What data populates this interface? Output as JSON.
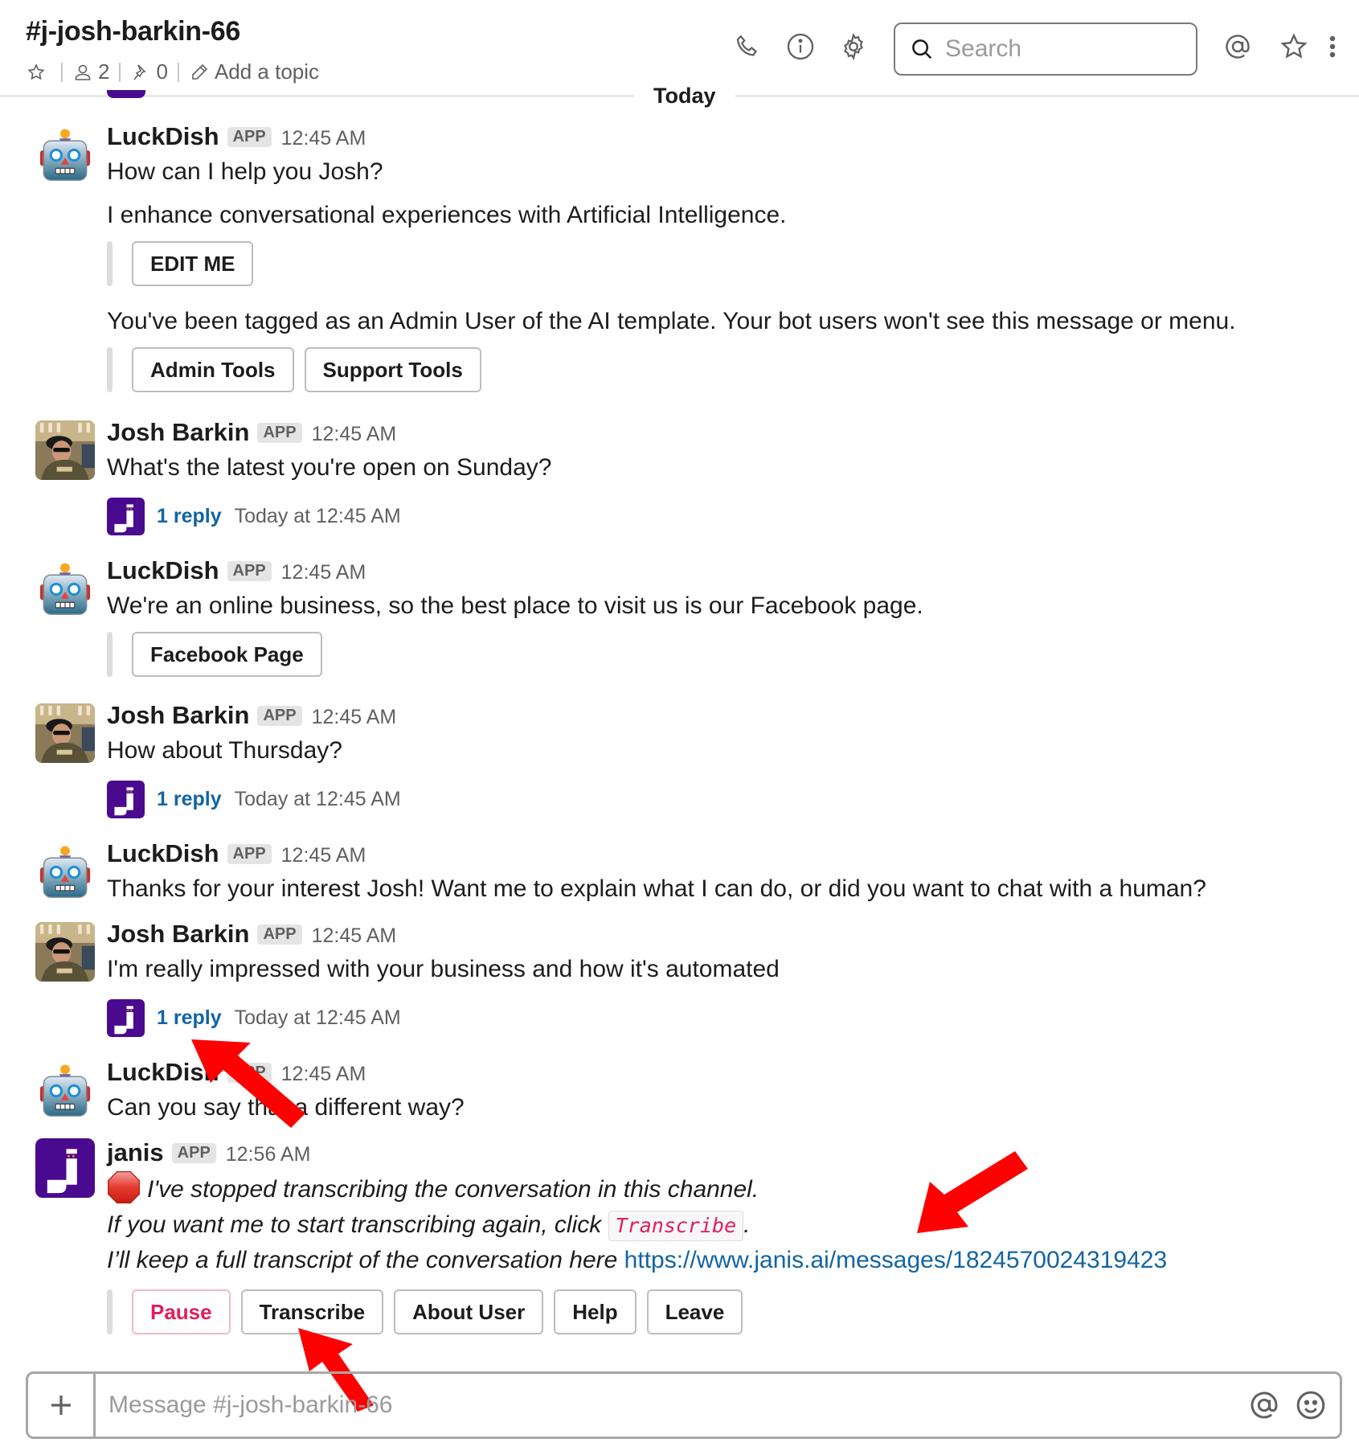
{
  "header": {
    "channel_name": "#j-josh-barkin-66",
    "member_count": "2",
    "pinned_count": "0",
    "topic_placeholder": "Add a topic",
    "search_placeholder": "Search"
  },
  "divider": {
    "label": "Today"
  },
  "messages": [
    {
      "sender": "LuckDish",
      "badge": "APP",
      "time": "12:45 AM",
      "lines": [
        "How can I help you Josh?",
        "I enhance conversational experiences with Artificial Intelligence."
      ],
      "buttons_1": [
        "EDIT ME"
      ],
      "line_2": "You've been tagged as an Admin User of the AI template. Your bot users won't see this message or menu.",
      "buttons_2": [
        "Admin Tools",
        "Support Tools"
      ]
    },
    {
      "sender": "Josh Barkin",
      "badge": "APP",
      "time": "12:45 AM",
      "text": "What's the latest you're open on Sunday?",
      "thread": {
        "reply_label": "1 reply",
        "reply_time": "Today at 12:45 AM"
      }
    },
    {
      "sender": "LuckDish",
      "badge": "APP",
      "time": "12:45 AM",
      "text": "We're an online business, so the best place to visit us is our Facebook page.",
      "buttons": [
        "Facebook Page"
      ]
    },
    {
      "sender": "Josh Barkin",
      "badge": "APP",
      "time": "12:45 AM",
      "text": "How about Thursday?",
      "thread": {
        "reply_label": "1 reply",
        "reply_time": "Today at 12:45 AM"
      }
    },
    {
      "sender": "LuckDish",
      "badge": "APP",
      "time": "12:45 AM",
      "text": "Thanks for your interest Josh! Want me to explain what I can do, or did you want to chat with a human?"
    },
    {
      "sender": "Josh Barkin",
      "badge": "APP",
      "time": "12:45 AM",
      "text": "I'm really impressed with your business and how it's automated",
      "thread": {
        "reply_label": "1 reply",
        "reply_time": "Today at 12:45 AM"
      }
    },
    {
      "sender": "LuckDish",
      "badge": "APP",
      "time": "12:45 AM",
      "text": "Can you say that a different way?"
    },
    {
      "sender": "janis",
      "badge": "APP",
      "time": "12:56 AM",
      "line_1": "I've stopped transcribing the conversation in this channel.",
      "line_2_prefix": "If you want me to start transcribing again, click ",
      "line_2_code": "Transcribe",
      "line_2_suffix": ".",
      "line_3_prefix": "I’ll keep a full transcript of the conversation here ",
      "line_3_link": "https://www.janis.ai/messages/1824570024319423",
      "buttons": [
        "Pause",
        "Transcribe",
        "About User",
        "Help",
        "Leave"
      ]
    }
  ],
  "composer": {
    "placeholder": "Message #j-josh-barkin-66"
  },
  "colors": {
    "janis_purple": "#4a0a8f",
    "link_blue": "#1264a3",
    "danger_pink": "#e01e5a",
    "annotation_red": "#ff0000"
  }
}
